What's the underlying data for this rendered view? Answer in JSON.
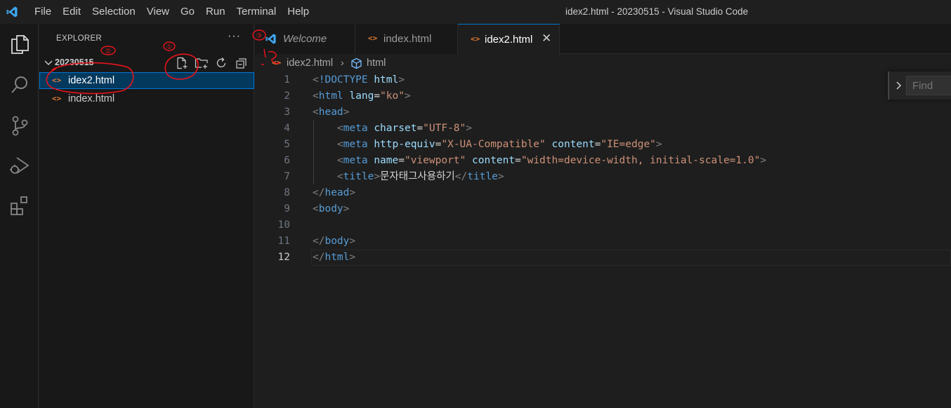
{
  "window": {
    "title": "idex2.html - 20230515 - Visual Studio Code"
  },
  "menu": [
    "File",
    "Edit",
    "Selection",
    "View",
    "Go",
    "Run",
    "Terminal",
    "Help"
  ],
  "activity_bar": [
    {
      "name": "explorer-icon"
    },
    {
      "name": "search-icon"
    },
    {
      "name": "source-control-icon"
    },
    {
      "name": "run-debug-icon"
    },
    {
      "name": "extensions-icon"
    }
  ],
  "sidebar": {
    "title": "EXPLORER",
    "more": "···",
    "folder": "20230515",
    "actions": [
      "new-file-icon",
      "new-folder-icon",
      "refresh-icon",
      "collapse-all-icon"
    ],
    "files": [
      {
        "icon": "<>",
        "label": "idex2.html",
        "active": true
      },
      {
        "icon": "<>",
        "label": "index.html",
        "active": false
      }
    ]
  },
  "tabs": [
    {
      "label": "Welcome",
      "icon": "vscode-logo-icon",
      "active": false
    },
    {
      "label": "index.html",
      "icon": "<>",
      "active": false
    },
    {
      "label": "idex2.html",
      "icon": "<>",
      "active": true,
      "close": "✕"
    }
  ],
  "breadcrumb": {
    "icon": "<>",
    "file": "idex2.html",
    "separator": "›",
    "symbol": "html"
  },
  "editor": {
    "current_line": 12,
    "lines": [
      {
        "n": "1",
        "t": [
          [
            "t-punc",
            "<"
          ],
          [
            "t-tag",
            "!DOCTYPE"
          ],
          [
            "t-text",
            " "
          ],
          [
            "t-attr",
            "html"
          ],
          [
            "t-punc",
            ">"
          ]
        ]
      },
      {
        "n": "2",
        "t": [
          [
            "t-punc",
            "<"
          ],
          [
            "t-tag",
            "html"
          ],
          [
            "t-text",
            " "
          ],
          [
            "t-attr",
            "lang"
          ],
          [
            "t-text",
            "="
          ],
          [
            "t-str",
            "\"ko\""
          ],
          [
            "t-punc",
            ">"
          ]
        ]
      },
      {
        "n": "3",
        "t": [
          [
            "t-punc",
            "<"
          ],
          [
            "t-tag",
            "head"
          ],
          [
            "t-punc",
            ">"
          ]
        ]
      },
      {
        "n": "4",
        "t": [
          [
            "t-text",
            "    "
          ],
          [
            "t-punc",
            "<"
          ],
          [
            "t-tag",
            "meta"
          ],
          [
            "t-text",
            " "
          ],
          [
            "t-attr",
            "charset"
          ],
          [
            "t-text",
            "="
          ],
          [
            "t-str",
            "\"UTF-8\""
          ],
          [
            "t-punc",
            ">"
          ]
        ]
      },
      {
        "n": "5",
        "t": [
          [
            "t-text",
            "    "
          ],
          [
            "t-punc",
            "<"
          ],
          [
            "t-tag",
            "meta"
          ],
          [
            "t-text",
            " "
          ],
          [
            "t-attr",
            "http-equiv"
          ],
          [
            "t-text",
            "="
          ],
          [
            "t-str",
            "\"X-UA-Compatible\""
          ],
          [
            "t-text",
            " "
          ],
          [
            "t-attr",
            "content"
          ],
          [
            "t-text",
            "="
          ],
          [
            "t-str",
            "\"IE=edge\""
          ],
          [
            "t-punc",
            ">"
          ]
        ]
      },
      {
        "n": "6",
        "t": [
          [
            "t-text",
            "    "
          ],
          [
            "t-punc",
            "<"
          ],
          [
            "t-tag",
            "meta"
          ],
          [
            "t-text",
            " "
          ],
          [
            "t-attr",
            "name"
          ],
          [
            "t-text",
            "="
          ],
          [
            "t-str",
            "\"viewport\""
          ],
          [
            "t-text",
            " "
          ],
          [
            "t-attr",
            "content"
          ],
          [
            "t-text",
            "="
          ],
          [
            "t-str",
            "\"width=device-width, initial-scale=1.0\""
          ],
          [
            "t-punc",
            ">"
          ]
        ]
      },
      {
        "n": "7",
        "t": [
          [
            "t-text",
            "    "
          ],
          [
            "t-punc",
            "<"
          ],
          [
            "t-tag",
            "title"
          ],
          [
            "t-punc",
            ">"
          ],
          [
            "t-text",
            "문자태그사용하기"
          ],
          [
            "t-punc",
            "</"
          ],
          [
            "t-tag",
            "title"
          ],
          [
            "t-punc",
            ">"
          ]
        ]
      },
      {
        "n": "8",
        "t": [
          [
            "t-punc",
            "</"
          ],
          [
            "t-tag",
            "head"
          ],
          [
            "t-punc",
            ">"
          ]
        ]
      },
      {
        "n": "9",
        "t": [
          [
            "t-punc",
            "<"
          ],
          [
            "t-tag",
            "body"
          ],
          [
            "t-punc",
            ">"
          ]
        ]
      },
      {
        "n": "10",
        "t": []
      },
      {
        "n": "11",
        "t": [
          [
            "t-punc",
            "</"
          ],
          [
            "t-tag",
            "body"
          ],
          [
            "t-punc",
            ">"
          ]
        ]
      },
      {
        "n": "12",
        "t": [
          [
            "t-punc",
            "</"
          ],
          [
            "t-tag",
            "html"
          ],
          [
            "t-punc",
            ">"
          ]
        ]
      }
    ]
  },
  "find": {
    "placeholder": "Find"
  },
  "annotations": {
    "circle_1": "①",
    "circle_2": "②",
    "circle_3": "③"
  },
  "colors": {
    "accent": "#0078d4",
    "html_icon": "#e37933",
    "tag": "#569cd6",
    "attr": "#9cdcfe",
    "string": "#ce9178",
    "annotation": "#e8141b"
  }
}
